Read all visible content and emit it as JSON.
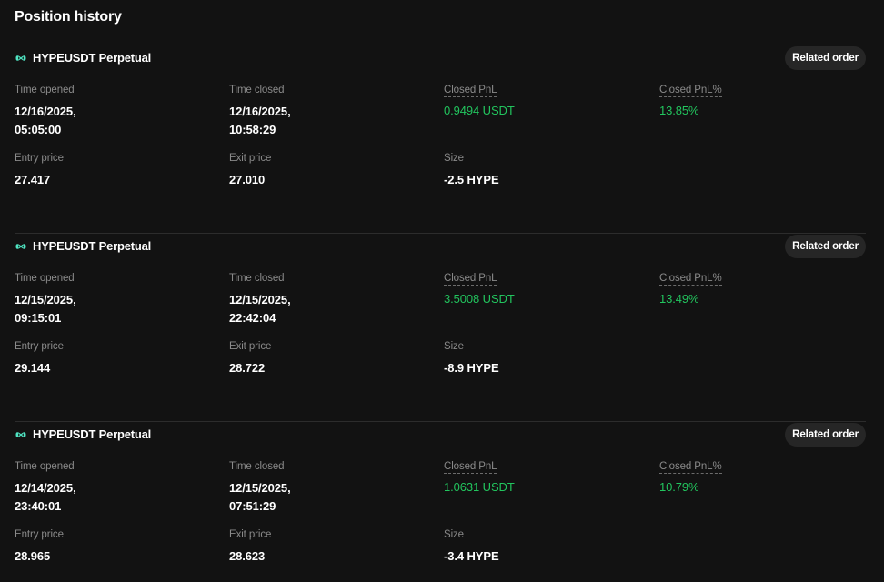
{
  "page": {
    "title": "Position history"
  },
  "labels": {
    "time_opened": "Time opened",
    "time_closed": "Time closed",
    "closed_pnl": "Closed PnL",
    "closed_pnl_pct": "Closed PnL%",
    "entry_price": "Entry price",
    "exit_price": "Exit price",
    "size": "Size",
    "related_order": "Related order"
  },
  "colors": {
    "background": "#121212",
    "profit": "#22c55e",
    "button_bg": "#262626",
    "icon": "#4fe3c1"
  },
  "positions": [
    {
      "symbol": "HYPEUSDT Perpetual",
      "icon": "hyperliquid-icon",
      "time_opened_date": "12/16/2025,",
      "time_opened_time": "05:05:00",
      "time_closed_date": "12/16/2025,",
      "time_closed_time": "10:58:29",
      "closed_pnl": "0.9494 USDT",
      "closed_pnl_pct": "13.85%",
      "entry_price": "27.417",
      "exit_price": "27.010",
      "size": "-2.5 HYPE"
    },
    {
      "symbol": "HYPEUSDT Perpetual",
      "icon": "hyperliquid-icon",
      "time_opened_date": "12/15/2025,",
      "time_opened_time": "09:15:01",
      "time_closed_date": "12/15/2025,",
      "time_closed_time": "22:42:04",
      "closed_pnl": "3.5008 USDT",
      "closed_pnl_pct": "13.49%",
      "entry_price": "29.144",
      "exit_price": "28.722",
      "size": "-8.9 HYPE"
    },
    {
      "symbol": "HYPEUSDT Perpetual",
      "icon": "hyperliquid-icon",
      "time_opened_date": "12/14/2025,",
      "time_opened_time": "23:40:01",
      "time_closed_date": "12/15/2025,",
      "time_closed_time": "07:51:29",
      "closed_pnl": "1.0631 USDT",
      "closed_pnl_pct": "10.79%",
      "entry_price": "28.965",
      "exit_price": "28.623",
      "size": "-3.4 HYPE"
    }
  ]
}
